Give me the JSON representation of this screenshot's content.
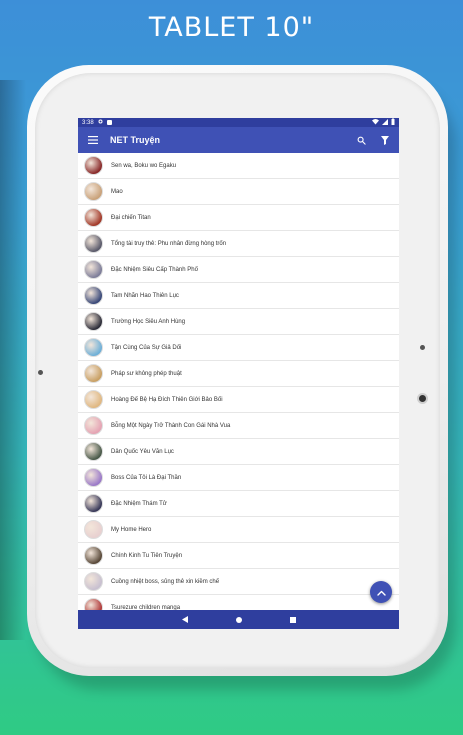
{
  "promo": {
    "title": "TABLET 10\""
  },
  "status_bar": {
    "time": "3:38"
  },
  "app_bar": {
    "title": "NET Truyện",
    "menu_icon": "menu-icon",
    "search_icon": "search-icon",
    "filter_icon": "filter-icon"
  },
  "colors": {
    "primary": "#3f51b5",
    "primary_dark": "#2f3e9e",
    "background_top": "#3d8fd8",
    "background_bottom": "#2fcb84"
  },
  "list": {
    "items": [
      {
        "title": "Sen wa, Boku wo Egaku",
        "thumb": "#8a2b2b"
      },
      {
        "title": "Mao",
        "thumb": "#c9a27a"
      },
      {
        "title": "Đại chiến Titan",
        "thumb": "#a33a2a"
      },
      {
        "title": "Tổng tài truy thê: Phu nhân đừng hòng trốn",
        "thumb": "#5b5b6b"
      },
      {
        "title": "Đặc Nhiệm Siêu Cấp Thành Phố",
        "thumb": "#7e7e9a"
      },
      {
        "title": "Tam Nhãn Hao Thiên Lục",
        "thumb": "#3b4a7a"
      },
      {
        "title": "Trường Học Siêu Anh Hùng",
        "thumb": "#2e2e3a"
      },
      {
        "title": "Tận Cùng Của Sự Giả Dối",
        "thumb": "#6fb0d8"
      },
      {
        "title": "Pháp sư không phép thuật",
        "thumb": "#c9a064"
      },
      {
        "title": "Hoàng Đế Bệ Hạ Đích Thiên Giới Bảo Bối",
        "thumb": "#e0b882"
      },
      {
        "title": "Bỗng Một Ngày Trở Thành Con Gái Nhà Vua",
        "thumb": "#e5a4b4"
      },
      {
        "title": "Dân Quốc Yêu Văn Lục",
        "thumb": "#4a5a4a"
      },
      {
        "title": "Boss Của Tôi Là Đại Thần",
        "thumb": "#9b7ac8"
      },
      {
        "title": "Đặc Nhiệm Thám Tử",
        "thumb": "#3a3a5a"
      },
      {
        "title": "My Home Hero",
        "thumb": "#e8d0d0"
      },
      {
        "title": "Chính Kinh Tu Tiên Truyện",
        "thumb": "#5a4a3a"
      },
      {
        "title": "Cuồng nhiệt boss, sủng thê xin kiềm chế",
        "thumb": "#c8c0d0"
      },
      {
        "title": "Tsurezure children manga",
        "thumb": "#b03a3a"
      }
    ]
  },
  "fab": {
    "icon": "chevron-up-icon"
  },
  "nav_bar": {
    "back_icon": "back-icon",
    "home_icon": "home-icon",
    "recents_icon": "recents-icon"
  }
}
